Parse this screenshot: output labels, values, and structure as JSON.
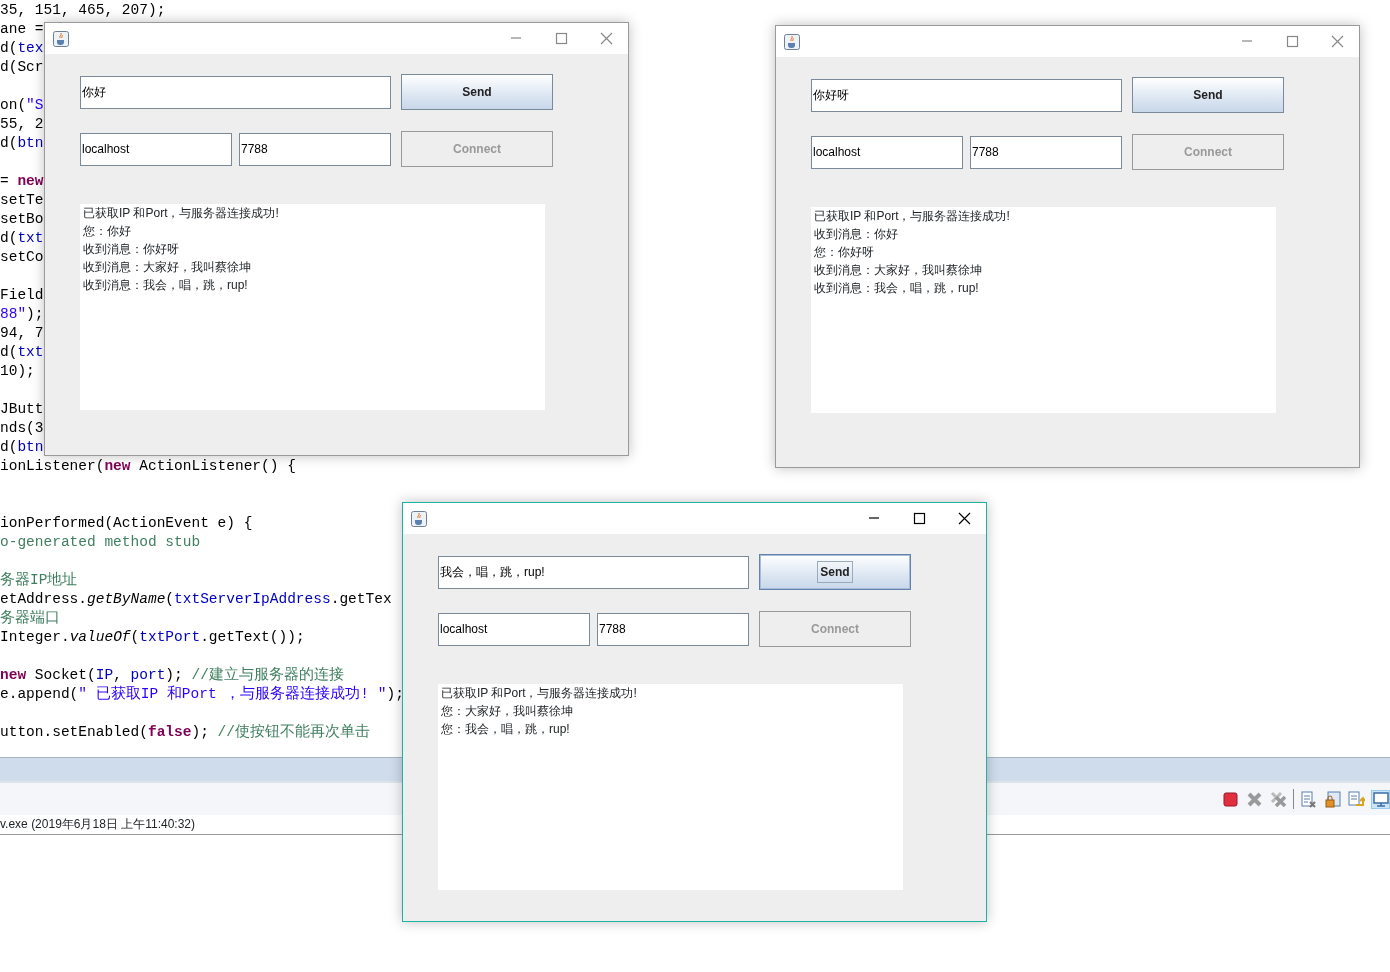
{
  "editor": {
    "code_lines": [
      {
        "segments": [
          {
            "text": "35, 151, 465, 207);",
            "kind": "plain"
          }
        ]
      },
      {
        "segments": [
          {
            "text": "ane =",
            "kind": "plain"
          }
        ]
      },
      {
        "segments": [
          {
            "text": "d(",
            "kind": "plain"
          },
          {
            "text": "tex",
            "kind": "field"
          }
        ]
      },
      {
        "segments": [
          {
            "text": "d(Scr",
            "kind": "plain"
          }
        ]
      },
      {
        "segments": [
          {
            "text": "on(",
            "kind": "plain"
          },
          {
            "text": "\"S",
            "kind": "string"
          }
        ]
      },
      {
        "segments": [
          {
            "text": "55, 2",
            "kind": "plain"
          }
        ]
      },
      {
        "segments": [
          {
            "text": "d(",
            "kind": "plain"
          },
          {
            "text": "btn",
            "kind": "field"
          }
        ]
      },
      {
        "segments": [
          {
            "text": "= ",
            "kind": "plain"
          },
          {
            "text": "new",
            "kind": "keyword"
          }
        ]
      },
      {
        "segments": [
          {
            "text": "setTe",
            "kind": "plain"
          }
        ]
      },
      {
        "segments": [
          {
            "text": "setBo",
            "kind": "plain"
          }
        ]
      },
      {
        "segments": [
          {
            "text": "d(",
            "kind": "plain"
          },
          {
            "text": "txt",
            "kind": "field"
          }
        ]
      },
      {
        "segments": [
          {
            "text": "setCo",
            "kind": "plain"
          }
        ]
      },
      {
        "segments": [
          {
            "text": "Field",
            "kind": "plain"
          }
        ]
      },
      {
        "segments": [
          {
            "text": "88\"",
            "kind": "string"
          },
          {
            "text": ");",
            "kind": "plain"
          }
        ]
      },
      {
        "segments": [
          {
            "text": "94, 7",
            "kind": "plain"
          }
        ]
      },
      {
        "segments": [
          {
            "text": "d(",
            "kind": "plain"
          },
          {
            "text": "txt",
            "kind": "field"
          }
        ]
      },
      {
        "segments": [
          {
            "text": "10);",
            "kind": "plain"
          }
        ]
      },
      {
        "segments": [
          {
            "text": "JButt",
            "kind": "plain"
          }
        ]
      },
      {
        "segments": [
          {
            "text": "nds(3",
            "kind": "plain"
          }
        ]
      },
      {
        "segments": [
          {
            "text": "d(",
            "kind": "plain"
          },
          {
            "text": "btn",
            "kind": "field"
          }
        ]
      },
      {
        "segments": [
          {
            "text": "ionListener(",
            "kind": "plain"
          },
          {
            "text": "new",
            "kind": "keyword"
          },
          {
            "text": " ActionListener() {",
            "kind": "plain"
          }
        ]
      },
      {
        "segments": [
          {
            "text": "ionPerformed(ActionEvent e) {",
            "kind": "plain"
          }
        ]
      },
      {
        "segments": [
          {
            "text": "o-generated method stub",
            "kind": "comment"
          }
        ]
      },
      {
        "segments": [
          {
            "text": "务器IP地址",
            "kind": "comment"
          }
        ]
      },
      {
        "segments": [
          {
            "text": "etAddress.",
            "kind": "plain"
          },
          {
            "text": "getByName",
            "kind": "static"
          },
          {
            "text": "(",
            "kind": "plain"
          },
          {
            "text": "txtServerIpAddress",
            "kind": "field"
          },
          {
            "text": ".getTex",
            "kind": "plain"
          }
        ]
      },
      {
        "segments": [
          {
            "text": "务器端口",
            "kind": "comment"
          }
        ]
      },
      {
        "segments": [
          {
            "text": "Integer.",
            "kind": "plain"
          },
          {
            "text": "valueOf",
            "kind": "static"
          },
          {
            "text": "(",
            "kind": "plain"
          },
          {
            "text": "txtPort",
            "kind": "field"
          },
          {
            "text": ".getText());",
            "kind": "plain"
          }
        ]
      },
      {
        "segments": [
          {
            "text": "new",
            "kind": "keyword"
          },
          {
            "text": " Socket(",
            "kind": "plain"
          },
          {
            "text": "IP",
            "kind": "field"
          },
          {
            "text": ", ",
            "kind": "plain"
          },
          {
            "text": "port",
            "kind": "field"
          },
          {
            "text": "); ",
            "kind": "plain"
          },
          {
            "text": "//建立与服务器的连接",
            "kind": "comment"
          }
        ]
      },
      {
        "segments": [
          {
            "text": "e.append(",
            "kind": "plain"
          },
          {
            "text": "\" 已获取IP 和Port ，与服务器连接成功! \"",
            "kind": "string"
          },
          {
            "text": ");",
            "kind": "plain"
          }
        ]
      },
      {
        "segments": [
          {
            "text": "utton.setEnabled(",
            "kind": "plain"
          },
          {
            "text": "false",
            "kind": "keyword"
          },
          {
            "text": "); ",
            "kind": "plain"
          },
          {
            "text": "//使按钮不能再次单击",
            "kind": "comment"
          }
        ]
      }
    ]
  },
  "console": {
    "toolbar": [
      {
        "kind": "stop",
        "selected": false
      },
      {
        "kind": "remove",
        "selected": false
      },
      {
        "kind": "remove-all",
        "selected": false
      },
      {
        "kind": "separator"
      },
      {
        "kind": "doc-x",
        "selected": false
      },
      {
        "kind": "lock",
        "selected": false
      },
      {
        "kind": "doc-arrow",
        "selected": false
      },
      {
        "kind": "monitor",
        "selected": true
      }
    ],
    "status": "v.exe (2019年6月18日 上午11:40:32)"
  },
  "windows": [
    {
      "active": false,
      "message": "你好",
      "send_label": "Send",
      "send_focused": false,
      "host": "localhost",
      "port": "7788",
      "connect_label": "Connect",
      "connect_disabled": true,
      "log": [
        "已获取IP 和Port，与服务器连接成功!",
        "您：你好",
        "收到消息：你好呀",
        "收到消息：大家好，我叫蔡徐坤",
        "收到消息：我会，唱，跳，rup!"
      ]
    },
    {
      "active": false,
      "message": "你好呀",
      "send_label": "Send",
      "send_focused": false,
      "host": "localhost",
      "port": "7788",
      "connect_label": "Connect",
      "connect_disabled": true,
      "log": [
        "已获取IP 和Port，与服务器连接成功!",
        "收到消息：你好",
        "您：你好呀",
        "收到消息：大家好，我叫蔡徐坤",
        "收到消息：我会，唱，跳，rup!"
      ]
    },
    {
      "active": true,
      "message": "我会，唱，跳，rup!",
      "send_label": "Send",
      "send_focused": true,
      "host": "localhost",
      "port": "7788",
      "connect_label": "Connect",
      "connect_disabled": true,
      "log": [
        "已获取IP 和Port，与服务器连接成功!",
        "您：大家好，我叫蔡徐坤",
        "您：我会，唱，跳，rup!"
      ]
    }
  ]
}
